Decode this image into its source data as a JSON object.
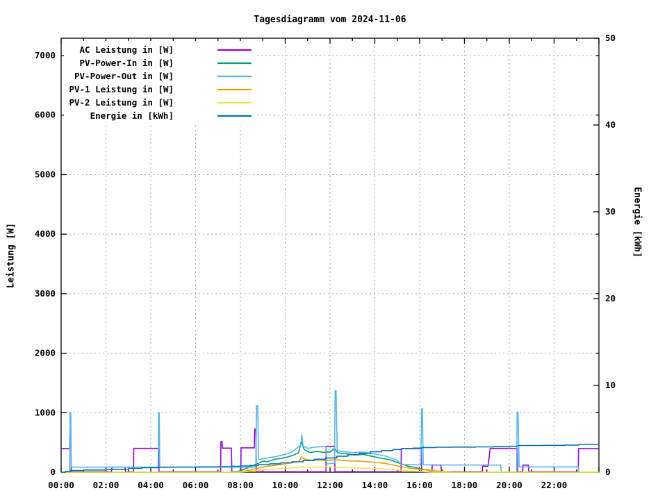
{
  "page": {
    "background": "#ffffff",
    "border_color": "#000000"
  },
  "chart_data": {
    "type": "line",
    "title": "Tagesdiagramm vom 2024-11-06",
    "xlabel": "",
    "ylabel_left": "Leistung [W]",
    "ylabel_right": "Energie [kWh]",
    "x_range_hours": [
      0,
      24
    ],
    "x_major_every_hours": 2,
    "x_minor_every_hours": 1,
    "x_tick_labels": [
      "00:00",
      "02:00",
      "04:00",
      "06:00",
      "08:00",
      "10:00",
      "12:00",
      "14:00",
      "16:00",
      "18:00",
      "20:00",
      "22:00"
    ],
    "y_left": {
      "range": [
        0,
        7292
      ],
      "ticks": [
        0,
        1000,
        2000,
        3000,
        4000,
        5000,
        6000,
        7000
      ]
    },
    "y_right": {
      "range": [
        0,
        50
      ],
      "ticks": [
        0,
        10,
        20,
        30,
        40,
        50
      ]
    },
    "grid": {
      "show": true,
      "color": "#a8a8a8",
      "style": "dotted"
    },
    "legend": {
      "position": "top-left",
      "background": "#ffffff"
    },
    "series": [
      {
        "name": "AC Leistung in [W]",
        "color": "#9400d3",
        "axis": "left",
        "style": "line",
        "points": [
          [
            0,
            395
          ],
          [
            0.38,
            395
          ],
          [
            0.4,
            700
          ],
          [
            0.43,
            700
          ],
          [
            0.45,
            8
          ],
          [
            2.25,
            8
          ],
          [
            2.27,
            85
          ],
          [
            2.85,
            85
          ],
          [
            2.87,
            8
          ],
          [
            3.23,
            8
          ],
          [
            3.24,
            400
          ],
          [
            4.35,
            400
          ],
          [
            4.37,
            8
          ],
          [
            7.12,
            8
          ],
          [
            7.13,
            515
          ],
          [
            7.18,
            515
          ],
          [
            7.2,
            405
          ],
          [
            7.6,
            405
          ],
          [
            7.62,
            8
          ],
          [
            8.02,
            8
          ],
          [
            8.03,
            410
          ],
          [
            8.62,
            410
          ],
          [
            8.64,
            725
          ],
          [
            8.69,
            725
          ],
          [
            8.71,
            8
          ],
          [
            11.82,
            8
          ],
          [
            11.83,
            435
          ],
          [
            12.2,
            435
          ],
          [
            12.22,
            8
          ],
          [
            15.17,
            8
          ],
          [
            15.18,
            398
          ],
          [
            16.07,
            398
          ],
          [
            16.09,
            8
          ],
          [
            16.55,
            8
          ],
          [
            16.56,
            120
          ],
          [
            16.95,
            120
          ],
          [
            16.97,
            8
          ],
          [
            18.8,
            8
          ],
          [
            18.81,
            100
          ],
          [
            19.05,
            100
          ],
          [
            19.15,
            400
          ],
          [
            20.35,
            400
          ],
          [
            20.37,
            8
          ],
          [
            20.6,
            8
          ],
          [
            20.61,
            120
          ],
          [
            20.85,
            120
          ],
          [
            20.87,
            8
          ],
          [
            23.08,
            8
          ],
          [
            23.09,
            395
          ],
          [
            24,
            395
          ]
        ]
      },
      {
        "name": "PV-Power-In in [W]",
        "color": "#009e73",
        "axis": "left",
        "style": "line",
        "points": [
          [
            0,
            0
          ],
          [
            7.7,
            0
          ],
          [
            8,
            25
          ],
          [
            8.3,
            70
          ],
          [
            8.6,
            120
          ],
          [
            8.8,
            150
          ],
          [
            9,
            185
          ],
          [
            9.2,
            175
          ],
          [
            9.5,
            215
          ],
          [
            9.8,
            235
          ],
          [
            10.1,
            255
          ],
          [
            10.4,
            290
          ],
          [
            10.6,
            330
          ],
          [
            10.72,
            520
          ],
          [
            10.85,
            380
          ],
          [
            11.1,
            330
          ],
          [
            11.4,
            350
          ],
          [
            11.7,
            335
          ],
          [
            12,
            340
          ],
          [
            12.2,
            400
          ],
          [
            12.35,
            325
          ],
          [
            12.7,
            310
          ],
          [
            13.1,
            290
          ],
          [
            13.5,
            300
          ],
          [
            13.9,
            265
          ],
          [
            14.3,
            235
          ],
          [
            14.7,
            205
          ],
          [
            15.1,
            150
          ],
          [
            15.5,
            100
          ],
          [
            15.9,
            70
          ],
          [
            16.3,
            40
          ],
          [
            16.7,
            20
          ],
          [
            17.1,
            8
          ],
          [
            17.4,
            0
          ],
          [
            24,
            0
          ]
        ]
      },
      {
        "name": "PV-Power-Out in [W]",
        "color": "#56b4e9",
        "axis": "left",
        "style": "line",
        "points": [
          [
            0,
            2
          ],
          [
            0.38,
            2
          ],
          [
            0.4,
            1000
          ],
          [
            0.43,
            1000
          ],
          [
            0.45,
            85
          ],
          [
            4.33,
            85
          ],
          [
            4.35,
            1000
          ],
          [
            4.38,
            1000
          ],
          [
            4.4,
            85
          ],
          [
            8.69,
            85
          ],
          [
            8.72,
            1120
          ],
          [
            8.77,
            1120
          ],
          [
            8.82,
            210
          ],
          [
            9.2,
            240
          ],
          [
            9.6,
            265
          ],
          [
            10,
            300
          ],
          [
            10.3,
            340
          ],
          [
            10.6,
            430
          ],
          [
            10.7,
            450
          ],
          [
            10.74,
            630
          ],
          [
            10.8,
            440
          ],
          [
            11,
            400
          ],
          [
            11.3,
            420
          ],
          [
            11.7,
            430
          ],
          [
            11.83,
            430
          ],
          [
            11.85,
            140
          ],
          [
            12.2,
            150
          ],
          [
            12.23,
            1370
          ],
          [
            12.27,
            1370
          ],
          [
            12.32,
            360
          ],
          [
            12.6,
            345
          ],
          [
            13,
            330
          ],
          [
            13.5,
            340
          ],
          [
            14,
            305
          ],
          [
            14.5,
            270
          ],
          [
            15,
            200
          ],
          [
            15.17,
            130
          ],
          [
            16.05,
            122
          ],
          [
            16.09,
            1070
          ],
          [
            16.12,
            1070
          ],
          [
            16.16,
            125
          ],
          [
            17,
            122
          ],
          [
            19,
            120
          ],
          [
            19.62,
            120
          ],
          [
            19.64,
            2
          ],
          [
            20.33,
            2
          ],
          [
            20.35,
            1010
          ],
          [
            20.39,
            1010
          ],
          [
            20.44,
            90
          ],
          [
            23.07,
            90
          ],
          [
            23.09,
            2
          ],
          [
            24,
            2
          ]
        ]
      },
      {
        "name": "PV-1 Leistung in [W]",
        "color": "#e69f00",
        "axis": "left",
        "style": "line",
        "points": [
          [
            0,
            0
          ],
          [
            7.75,
            0
          ],
          [
            8.1,
            15
          ],
          [
            8.5,
            40
          ],
          [
            8.8,
            70
          ],
          [
            9.1,
            95
          ],
          [
            9.4,
            110
          ],
          [
            9.7,
            125
          ],
          [
            10,
            140
          ],
          [
            10.3,
            160
          ],
          [
            10.6,
            175
          ],
          [
            10.72,
            260
          ],
          [
            10.9,
            215
          ],
          [
            11.2,
            200
          ],
          [
            11.5,
            205
          ],
          [
            11.9,
            195
          ],
          [
            12.2,
            212
          ],
          [
            12.5,
            200
          ],
          [
            12.9,
            190
          ],
          [
            13.3,
            185
          ],
          [
            13.7,
            175
          ],
          [
            14.1,
            165
          ],
          [
            14.5,
            145
          ],
          [
            14.9,
            115
          ],
          [
            15.3,
            85
          ],
          [
            15.7,
            60
          ],
          [
            16.1,
            45
          ],
          [
            16.5,
            28
          ],
          [
            16.9,
            15
          ],
          [
            17.3,
            6
          ],
          [
            17.6,
            0
          ],
          [
            24,
            0
          ]
        ]
      },
      {
        "name": "PV-2 Leistung in [W]",
        "color": "#f0e442",
        "axis": "left",
        "style": "line",
        "points": [
          [
            0,
            0
          ],
          [
            7.85,
            0
          ],
          [
            8.2,
            8
          ],
          [
            8.6,
            25
          ],
          [
            9,
            40
          ],
          [
            9.4,
            52
          ],
          [
            9.8,
            62
          ],
          [
            10.2,
            70
          ],
          [
            10.6,
            78
          ],
          [
            10.72,
            100
          ],
          [
            10.9,
            82
          ],
          [
            11.3,
            86
          ],
          [
            11.7,
            90
          ],
          [
            12.1,
            88
          ],
          [
            12.5,
            82
          ],
          [
            12.9,
            74
          ],
          [
            13.3,
            70
          ],
          [
            13.7,
            66
          ],
          [
            14.1,
            60
          ],
          [
            14.5,
            52
          ],
          [
            14.9,
            40
          ],
          [
            15.3,
            28
          ],
          [
            15.7,
            18
          ],
          [
            16.1,
            10
          ],
          [
            16.5,
            4
          ],
          [
            16.8,
            0
          ],
          [
            24,
            0
          ]
        ]
      },
      {
        "name": "Energie in [kWh]",
        "color": "#0072b2",
        "axis": "right",
        "style": "steps",
        "points": [
          [
            0,
            0
          ],
          [
            0.2,
            0.1
          ],
          [
            0.42,
            0.2
          ],
          [
            1,
            0.26
          ],
          [
            2,
            0.34
          ],
          [
            3,
            0.44
          ],
          [
            3.6,
            0.52
          ],
          [
            4.3,
            0.58
          ],
          [
            5,
            0.6
          ],
          [
            6,
            0.62
          ],
          [
            7,
            0.64
          ],
          [
            7.6,
            0.68
          ],
          [
            8,
            0.72
          ],
          [
            8.4,
            0.78
          ],
          [
            8.8,
            0.88
          ],
          [
            9.3,
            0.97
          ],
          [
            9.8,
            1.08
          ],
          [
            10.3,
            1.2
          ],
          [
            10.8,
            1.35
          ],
          [
            11.3,
            1.5
          ],
          [
            11.8,
            1.65
          ],
          [
            12.3,
            1.85
          ],
          [
            12.8,
            2.02
          ],
          [
            13.3,
            2.18
          ],
          [
            13.8,
            2.35
          ],
          [
            14.3,
            2.5
          ],
          [
            14.8,
            2.62
          ],
          [
            15.2,
            2.72
          ],
          [
            15.7,
            2.78
          ],
          [
            16.1,
            2.85
          ],
          [
            16.7,
            2.88
          ],
          [
            17.5,
            2.9
          ],
          [
            18.5,
            2.92
          ],
          [
            19.3,
            2.95
          ],
          [
            20,
            3
          ],
          [
            20.4,
            3.08
          ],
          [
            21.5,
            3.1
          ],
          [
            22.5,
            3.13
          ],
          [
            23.1,
            3.2
          ],
          [
            24,
            3.22
          ]
        ]
      }
    ]
  }
}
